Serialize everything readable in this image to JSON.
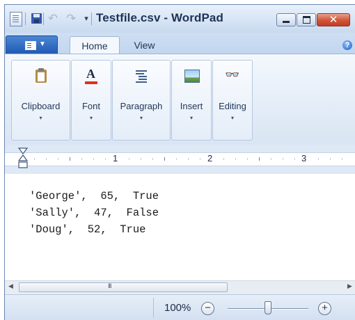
{
  "window": {
    "title": "Testfile.csv - WordPad"
  },
  "quick_access": {
    "icons": [
      "app-icon",
      "save-icon",
      "undo-icon",
      "redo-icon",
      "customize-toolbar-icon"
    ],
    "customize_glyph": "▾"
  },
  "title_buttons": {
    "close_glyph": "✕"
  },
  "tabs": [
    {
      "label": "Home",
      "active": true
    },
    {
      "label": "View",
      "active": false
    }
  ],
  "help_glyph": "?",
  "ribbon": {
    "groups": [
      {
        "label": "Clipboard",
        "icon": "clipboard-icon"
      },
      {
        "label": "Font",
        "icon": "font-icon"
      },
      {
        "label": "Paragraph",
        "icon": "paragraph-icon"
      },
      {
        "label": "Insert",
        "icon": "insert-picture-icon"
      },
      {
        "label": "Editing",
        "icon": "binoculars-icon"
      }
    ],
    "caret": "▾",
    "font_icon_letter": "A"
  },
  "ruler": {
    "numbers": [
      "1",
      "2",
      "3"
    ]
  },
  "document": {
    "lines": [
      "'George',  65,  True",
      "'Sally',  47,  False",
      "'Doug',  52,  True"
    ]
  },
  "scrollbar": {
    "left_glyph": "◀",
    "right_glyph": "▶",
    "grip": "III"
  },
  "status": {
    "zoom_level": "100%",
    "zoom_out_glyph": "−",
    "zoom_in_glyph": "+",
    "zoom_slider_fraction": 0.5
  },
  "colors": {
    "accent": "#1f58b3",
    "close_button": "#c23c22"
  }
}
